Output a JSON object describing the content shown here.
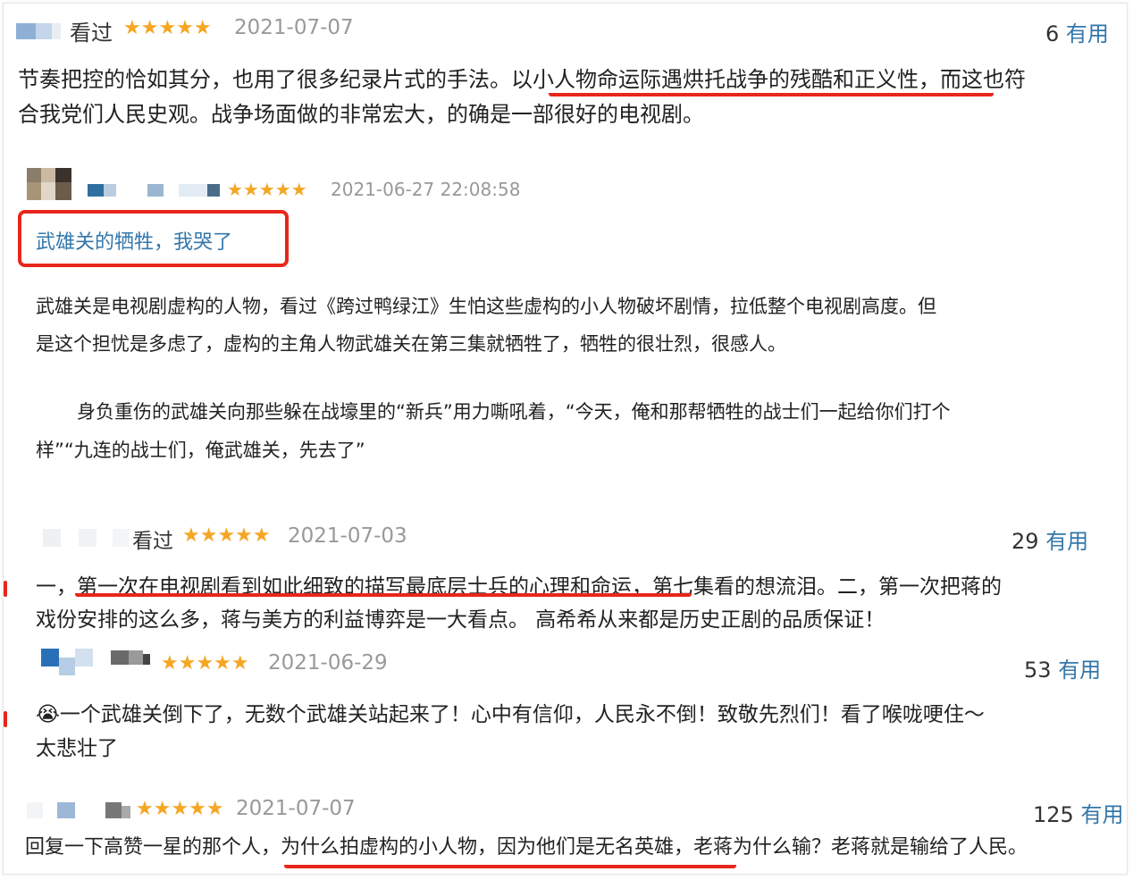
{
  "reviews": [
    {
      "status": "看过",
      "stars": "★★★★★",
      "date": "2021-07-07",
      "useful_count": "6",
      "useful_label": "有用",
      "line1a": "节奏把控的恰如其分，也用了很多纪录片式的手法。",
      "line1b": "以小人物命运际遇烘托战争的残酷和正义性",
      "line1c": "，而这也符",
      "line2": "合我党们人民史观。战争场面做的非常宏大，的确是一部很好的电视剧。"
    },
    {
      "stars": "★★★★★",
      "date": "2021-06-27 22:08:58",
      "title": "武雄关的牺牲，我哭了",
      "p1_line1": "武雄关是电视剧虚构的人物，看过《跨过鸭绿江》生怕这些虚构的小人物破坏剧情，拉低整个电视剧高度。但",
      "p1_line2": "是这个担忧是多虑了，虚构的主角人物武雄关在第三集就牺牲了，牺牲的很壮烈，很感人。",
      "p2_line1": "身负重伤的武雄关向那些躲在战壕里的“新兵”用力嘶吼着，“今天，俺和那帮牺牲的战士们一起给你们打个",
      "p2_line2": "样”“九连的战士们，俺武雄关，先去了”"
    },
    {
      "status": "看过",
      "stars": "★★★★★",
      "date": "2021-07-03",
      "useful_count": "29",
      "useful_label": "有用",
      "line1a": "一，",
      "line1b": "第一次在电视剧看到如此细致的描写最底层士兵的心理和命运",
      "line1c": "，第七集看的想流泪。二，第一次把蒋的",
      "line2": "戏份安排的这么多，蒋与美方的利益博弈是一大看点。 高希希从来都是历史正剧的品质保证！"
    },
    {
      "stars": "★★★★★",
      "date": "2021-06-29",
      "useful_count": "53",
      "useful_label": "有用",
      "emoji": "😭",
      "line1": "一个武雄关倒下了，无数个武雄关站起来了！心中有信仰，人民永不倒！致敬先烈们！看了喉咙哽住～",
      "line2": "太悲壮了"
    },
    {
      "stars": "★★★★★",
      "date": "2021-07-07",
      "useful_count": "125",
      "useful_label": "有用",
      "line1a": "回复一下高赞一星的那个人，",
      "line1b": "为什么拍虚构的小人物，因为他们是无名英雄",
      "line1c": "，老蒋为什么输？老蒋就是输给了人民。"
    }
  ],
  "colors": {
    "star": "#f5a623",
    "link": "#3377aa",
    "annotation": "#e8261b",
    "date": "#999999"
  }
}
